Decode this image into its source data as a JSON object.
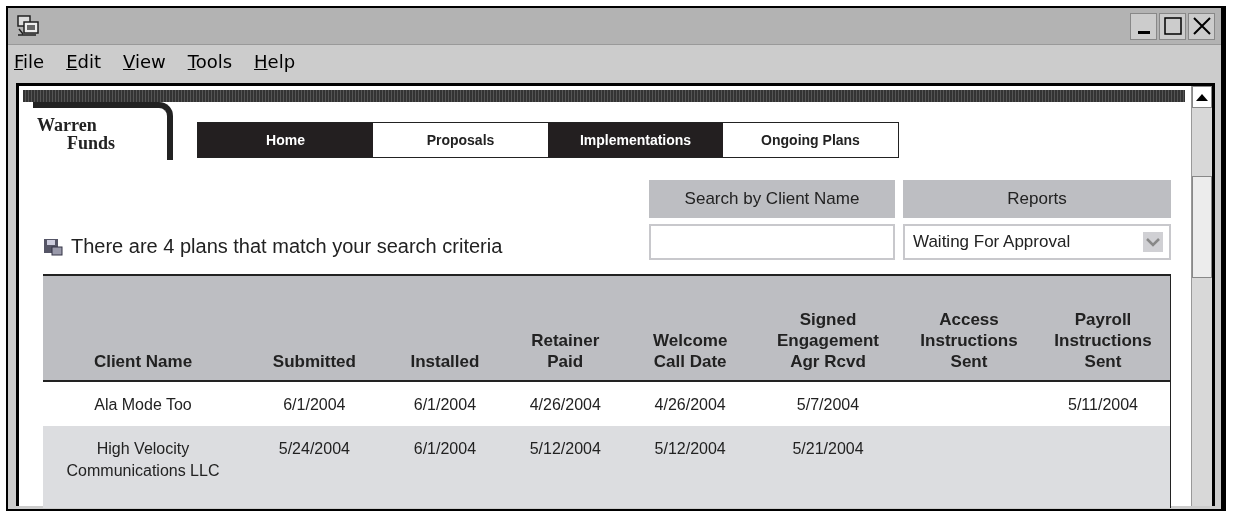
{
  "menu": [
    "File",
    "Edit",
    "View",
    "Tools",
    "Help"
  ],
  "logo": {
    "line1": "Warren",
    "line2": "Funds"
  },
  "nav_tabs": [
    {
      "label": "Home",
      "dark": true
    },
    {
      "label": "Proposals",
      "dark": false
    },
    {
      "label": "Implementations",
      "dark": true
    },
    {
      "label": "Ongoing Plans",
      "dark": false
    }
  ],
  "search": {
    "label": "Search by Client Name"
  },
  "reports": {
    "label": "Reports",
    "value": "Waiting For Approval"
  },
  "result_message": "There are 4 plans that match your search criteria",
  "table": {
    "columns": [
      "Client Name",
      "Submitted",
      "Installed",
      "Retainer\nPaid",
      "Welcome\nCall Date",
      "Signed\nEngagement\nAgr Rcvd",
      "Access\nInstructions\nSent",
      "Payroll\nInstructions\nSent"
    ],
    "rows": [
      {
        "cells": [
          "Ala Mode Too",
          "6/1/2004",
          "6/1/2004",
          "4/26/2004",
          "4/26/2004",
          "5/7/2004",
          null,
          "5/11/2004"
        ]
      },
      {
        "cells": [
          "High Velocity\nCommunications LLC",
          "5/24/2004",
          "6/1/2004",
          "5/12/2004",
          "5/12/2004",
          "5/21/2004",
          null,
          null
        ]
      }
    ]
  }
}
